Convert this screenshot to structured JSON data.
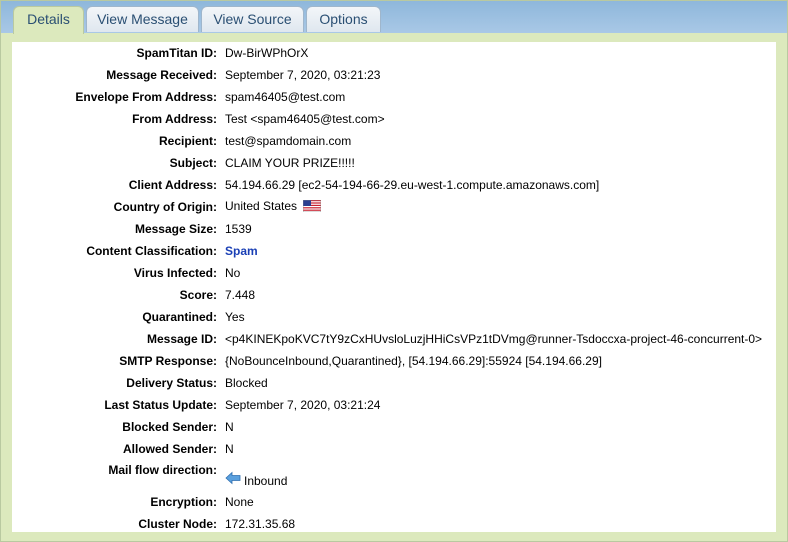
{
  "tabs": [
    {
      "label": "Details"
    },
    {
      "label": "View Message"
    },
    {
      "label": "View Source"
    },
    {
      "label": "Options"
    }
  ],
  "details": {
    "spamtitan_id": {
      "label": "SpamTitan ID:",
      "value": "Dw-BirWPhOrX"
    },
    "message_received": {
      "label": "Message Received:",
      "value": "September 7, 2020, 03:21:23"
    },
    "envelope_from": {
      "label": "Envelope From Address:",
      "value": "spam46405@test.com"
    },
    "from_address": {
      "label": "From Address:",
      "value": "Test <spam46405@test.com>"
    },
    "recipient": {
      "label": "Recipient:",
      "value": "test@spamdomain.com"
    },
    "subject": {
      "label": "Subject:",
      "value": "CLAIM YOUR PRIZE!!!!!"
    },
    "client_address": {
      "label": "Client Address:",
      "value": "54.194.66.29 [ec2-54-194-66-29.eu-west-1.compute.amazonaws.com]"
    },
    "country": {
      "label": "Country of Origin:",
      "value": "United States",
      "icon": "us-flag-icon"
    },
    "message_size": {
      "label": "Message Size:",
      "value": "1539"
    },
    "classification": {
      "label": "Content Classification:",
      "value": "Spam"
    },
    "virus": {
      "label": "Virus Infected:",
      "value": "No"
    },
    "score": {
      "label": "Score:",
      "value": "7.448"
    },
    "quarantined": {
      "label": "Quarantined:",
      "value": "Yes"
    },
    "message_id": {
      "label": "Message ID:",
      "value": "<p4KINEKpoKVC7tY9zCxHUvsloLuzjHHiCsVPz1tDVmg@runner-Tsdoccxa-project-46-concurrent-0>"
    },
    "smtp_response": {
      "label": "SMTP Response:",
      "value": "{NoBounceInbound,Quarantined}, [54.194.66.29]:55924 [54.194.66.29]"
    },
    "delivery_status": {
      "label": "Delivery Status:",
      "value": "Blocked"
    },
    "last_status_update": {
      "label": "Last Status Update:",
      "value": "September 7, 2020, 03:21:24"
    },
    "blocked_sender": {
      "label": "Blocked Sender:",
      "value": "N"
    },
    "allowed_sender": {
      "label": "Allowed Sender:",
      "value": "N"
    },
    "mail_flow": {
      "label": "Mail flow direction:",
      "value": "Inbound",
      "icon": "inbound-arrow-icon"
    },
    "encryption": {
      "label": "Encryption:",
      "value": "None"
    },
    "cluster_node": {
      "label": "Cluster Node:",
      "value": "172.31.35.68"
    }
  },
  "colors": {
    "tabbar": "#a9c8e6",
    "panel": "#dce9bd",
    "link": "#1a3fb5"
  }
}
